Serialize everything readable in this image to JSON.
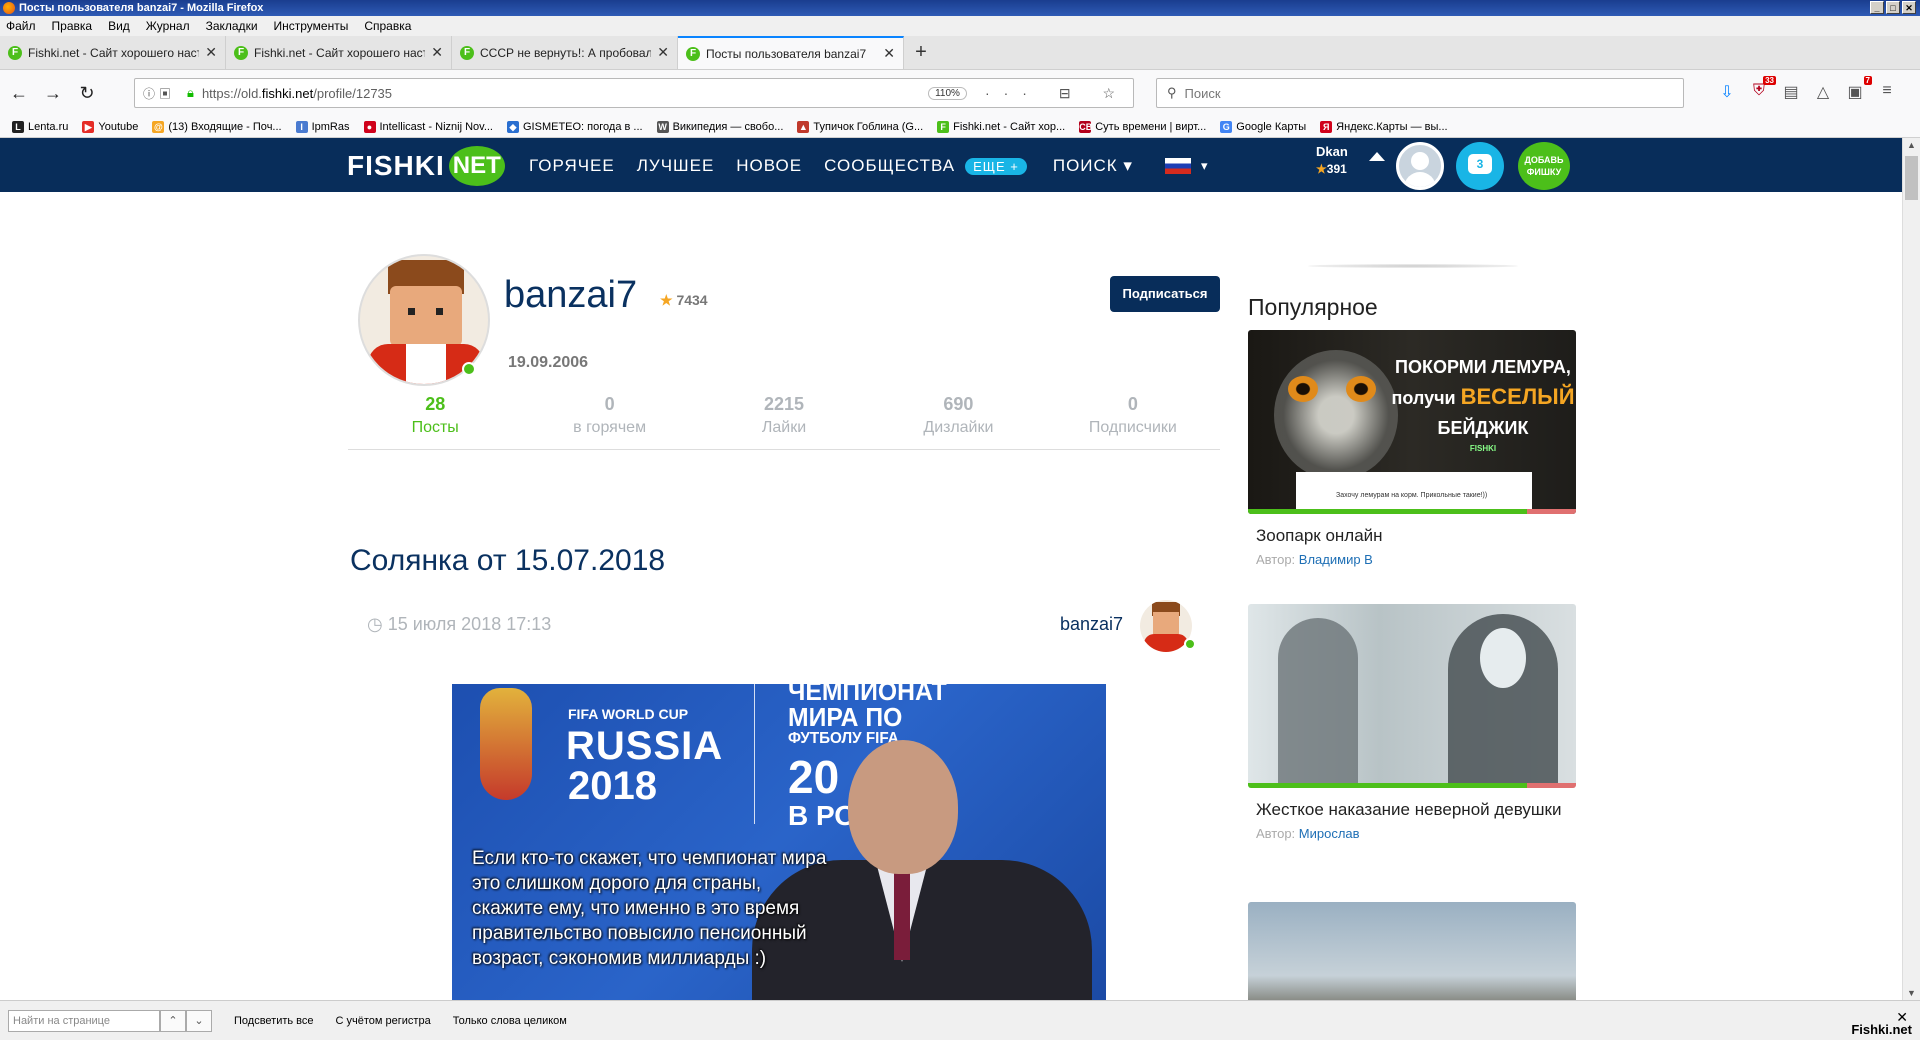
{
  "window": {
    "title": "Посты пользователя banzai7 - Mozilla Firefox",
    "controls": [
      "_",
      "□",
      "✕"
    ]
  },
  "menu": [
    "Файл",
    "Правка",
    "Вид",
    "Журнал",
    "Закладки",
    "Инструменты",
    "Справка"
  ],
  "tabs": [
    {
      "label": "Fishki.net - Сайт хорошего настр",
      "close": "✕"
    },
    {
      "label": "Fishki.net - Сайт хорошего настр",
      "close": "✕"
    },
    {
      "label": "СССР не вернуть!: А пробовал",
      "close": "✕"
    },
    {
      "label": "Посты пользователя banzai7",
      "close": "✕"
    }
  ],
  "newtab": "+",
  "nav": {
    "back": "←",
    "forward": "→",
    "reload": "↻",
    "url_prefix": "https://old.",
    "url_domain": "fishki.net",
    "url_path": "/profile/12735",
    "zoom": "110%",
    "page_actions": "··· ⊟ ☆",
    "search_placeholder": "Поиск"
  },
  "toolbar": {
    "download": "⇩",
    "badge1": "33",
    "library": "▤",
    "sync": "△",
    "badge2": "7",
    "menu": "≡"
  },
  "bookmarks": [
    {
      "label": "Lenta.ru",
      "icon": "L",
      "color": "#222222"
    },
    {
      "label": "Youtube",
      "icon": "▶",
      "color": "#e52d27"
    },
    {
      "label": "(13) Входящие - Поч...",
      "icon": "@",
      "color": "#f5a623"
    },
    {
      "label": "IpmRas",
      "icon": "I",
      "color": "#4a7bd0"
    },
    {
      "label": "Intellicast - Niznij Nov...",
      "icon": "●",
      "color": "#d0021b"
    },
    {
      "label": "GISMETEO: погода в ...",
      "icon": "◆",
      "color": "#2a6fd0"
    },
    {
      "label": "Википедия — свобо...",
      "icon": "W",
      "color": "#555555"
    },
    {
      "label": "Тупичок Гоблина (G...",
      "icon": "▲",
      "color": "#c0392b"
    },
    {
      "label": "Fishki.net - Сайт хор...",
      "icon": "F",
      "color": "#4cbf1a"
    },
    {
      "label": "Суть времени | вирт...",
      "icon": "СВ",
      "color": "#b3001b"
    },
    {
      "label": "Google Карты",
      "icon": "G",
      "color": "#4285f4"
    },
    {
      "label": "Яндекс.Карты — вы...",
      "icon": "Я",
      "color": "#d0021b"
    }
  ],
  "site": {
    "logo": "FISHKI",
    "logo_net": "NET",
    "nav": [
      "ГОРЯЧЕЕ",
      "ЛУЧШЕЕ",
      "НОВОЕ",
      "СООБЩЕСТВА"
    ],
    "more": "ЕЩЕ +",
    "search": "ПОИСК ▾",
    "lang_caret": "▾",
    "user_name": "Dkan",
    "user_rating": "391",
    "messages": "3",
    "add_post": "ДОБАВЬ ФИШКУ"
  },
  "profile": {
    "name": "banzai7",
    "rating": "7434",
    "date": "19.09.2006",
    "subscribe": "Подписаться",
    "stats": [
      {
        "num": "28",
        "label": "Посты"
      },
      {
        "num": "0",
        "label": "в горячем"
      },
      {
        "num": "2215",
        "label": "Лайки"
      },
      {
        "num": "690",
        "label": "Дизлайки"
      },
      {
        "num": "0",
        "label": "Подписчики"
      }
    ]
  },
  "post": {
    "title": "Солянка от 15.07.2018",
    "date": "15 июля 2018 17:13",
    "author": "banzai7",
    "image": {
      "fifa": "FIFA WORLD CUP",
      "russia": "RUSSIA",
      "year": "2018",
      "ru_line1": "ЧЕМПИОНАТ",
      "ru_line2": "МИРА ПО",
      "ru_line3": "ФУТБОЛУ FIFA",
      "ru_big": "20",
      "ru_bottom": "В РОС",
      "caption": "Если кто-то скажет, что чемпионат мира это слишком дорого для страны, скажите ему, что именно в это время правительство повысило пенсионный возраст, сэкономив миллиарды :)"
    }
  },
  "sidebar": {
    "title": "Популярное",
    "cards": [
      {
        "title": "Зоопарк онлайн",
        "author_prefix": "Автор:",
        "author": "Владимир В",
        "banner_l1": "ПОКОРМИ ЛЕМУРА,",
        "banner_l2": "получи",
        "banner_em": "ВЕСЕЛЫЙ",
        "banner_l3": "БЕЙДЖИК",
        "banner_brand": "FISHKI",
        "shot_caption": "Захочу лемурам на корм. Прикольные такие!))"
      },
      {
        "title": "Жесткое наказание неверной девушки",
        "author_prefix": "Автор:",
        "author": "Мирослав"
      },
      {
        "title": "",
        "author_prefix": "",
        "author": ""
      }
    ]
  },
  "findbar": {
    "placeholder": "Найти на странице",
    "highlight": "Подсветить все",
    "case": "С учётом регистра",
    "whole": "Только слова целиком",
    "close": "✕",
    "watermark": "Fishki.net"
  }
}
